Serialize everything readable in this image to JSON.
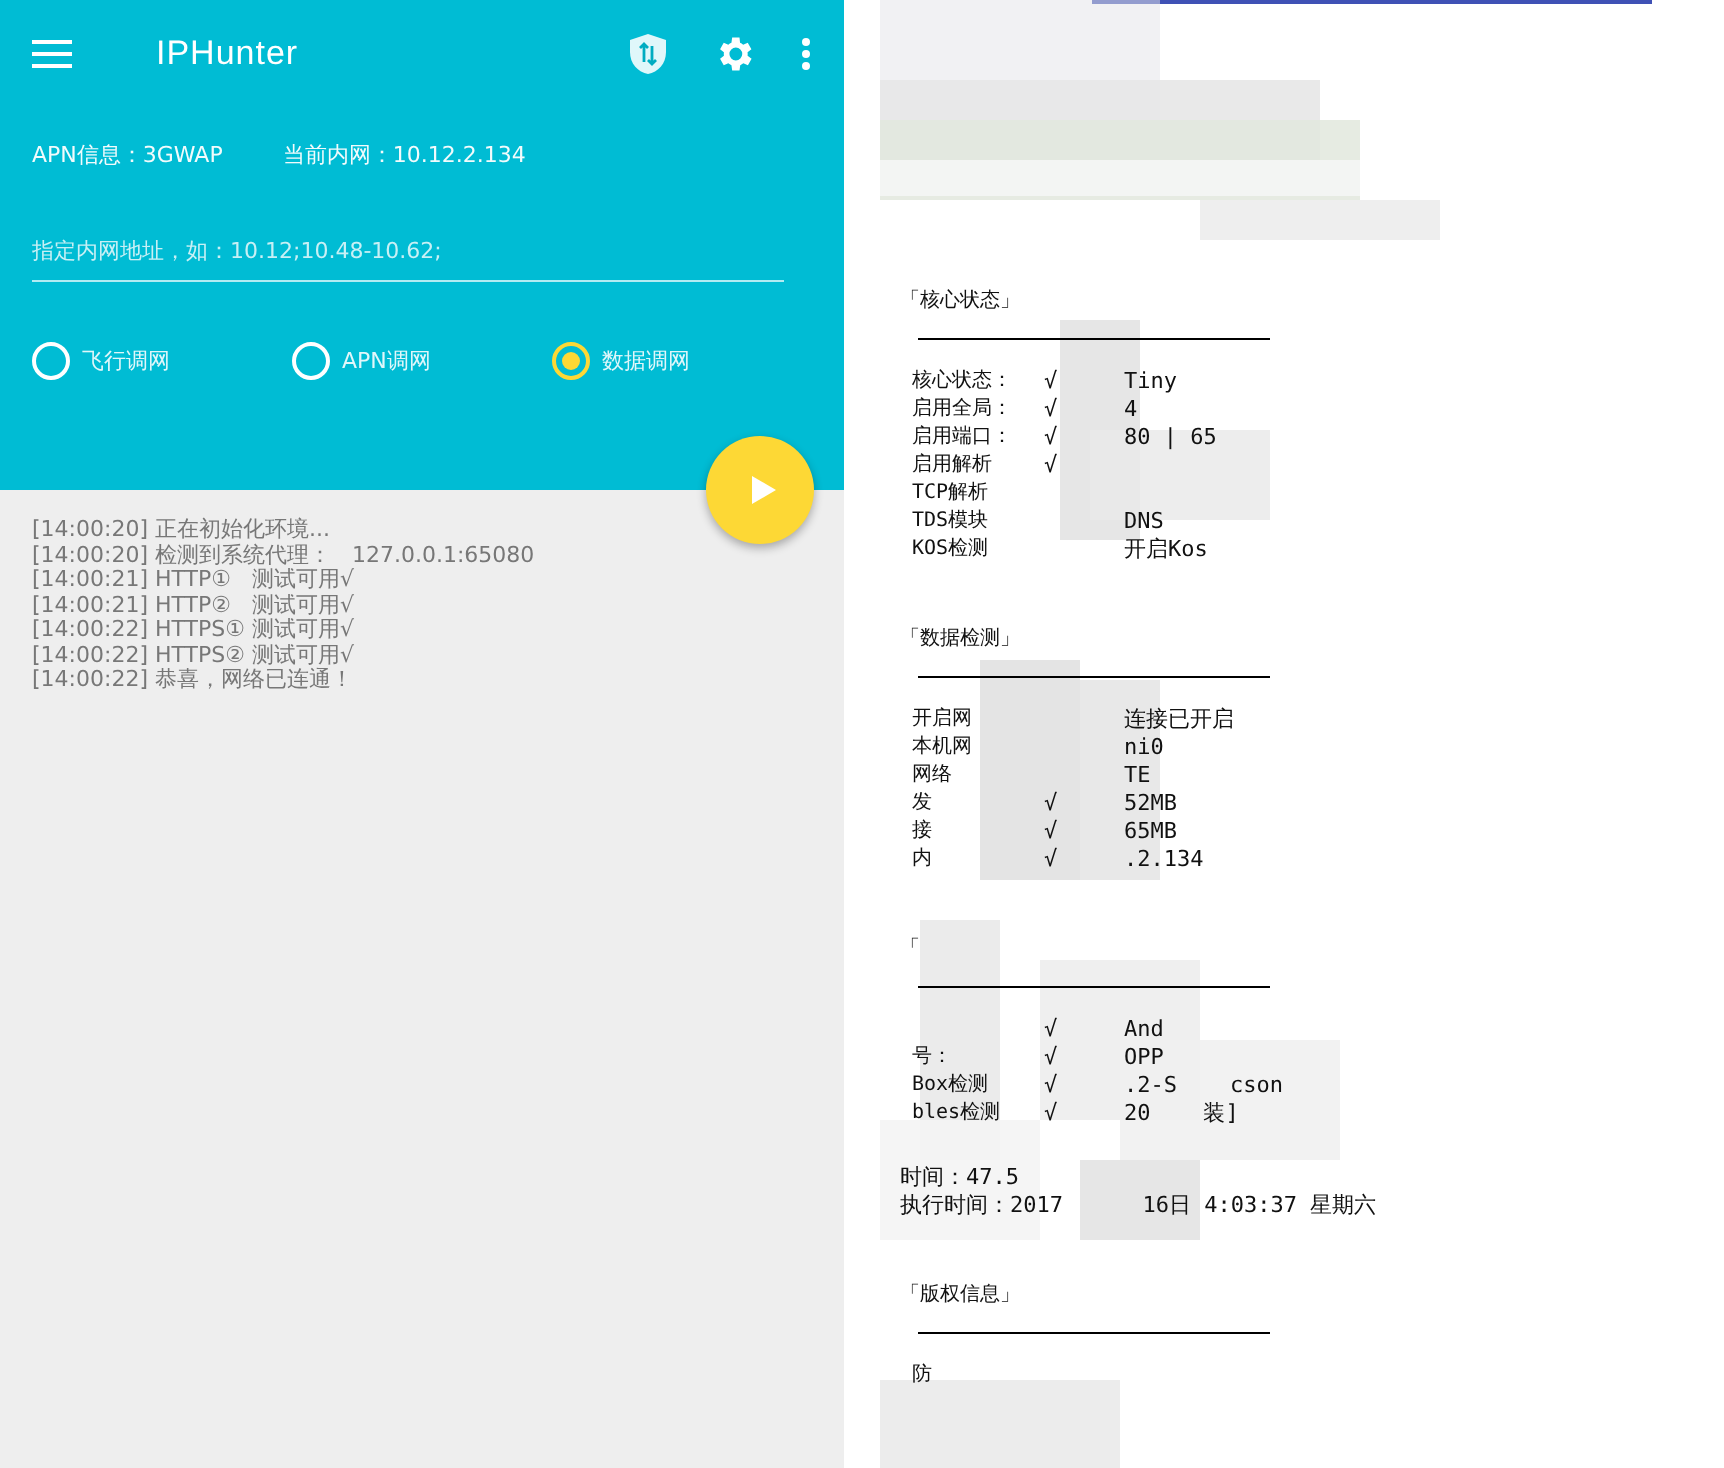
{
  "app_bar": {
    "title": "IPHunter"
  },
  "info": {
    "apn": "APN信息：3GWAP",
    "intranet": "当前内网：10.12.2.134"
  },
  "address_field": {
    "placeholder": "指定内网地址，如：10.12;10.48-10.62;"
  },
  "modes": [
    {
      "label": "飞行调网",
      "selected": false
    },
    {
      "label": "APN调网",
      "selected": false
    },
    {
      "label": "数据调网",
      "selected": true
    }
  ],
  "log": [
    "[14:00:20] 正在初始化环境...",
    "[14:00:20] 检测到系统代理：   127.0.0.1:65080",
    "[14:00:21] HTTP①   测试可用√",
    "[14:00:21] HTTP②   测试可用√",
    "[14:00:22] HTTPS① 测试可用√",
    "[14:00:22] HTTPS② 测试可用√",
    "[14:00:22] 恭喜，网络已连通！"
  ],
  "report": {
    "sections": [
      {
        "title": "「核心状态」",
        "rows": [
          {
            "label": "核心状态：",
            "check": "√",
            "value": "Tiny"
          },
          {
            "label": "启用全局：",
            "check": "√",
            "value": "4"
          },
          {
            "label": "启用端口：",
            "check": "√",
            "value": "80 | 65"
          },
          {
            "label": "启用解析",
            "check": "√"
          },
          {
            "label": "TCP解析"
          },
          {
            "label": "TDS模块",
            "value": "DNS"
          },
          {
            "label": "KOS检测",
            "value": "开启Kos"
          }
        ]
      },
      {
        "title": "「数据检测」",
        "rows": [
          {
            "label": "开启网",
            "value": "连接已开启"
          },
          {
            "label": "本机网",
            "value": "ni0"
          },
          {
            "label": "网络",
            "value": "TE"
          },
          {
            "label": "发",
            "check": "√",
            "value": "52MB"
          },
          {
            "label": "接",
            "check": "√",
            "value": "65MB"
          },
          {
            "label": "内",
            "check": "√",
            "value": ".2.134"
          }
        ]
      },
      {
        "title": "「",
        "rows": [
          {
            "label": "",
            "check": "√",
            "value": "And"
          },
          {
            "label": "号：",
            "check": "√",
            "value": "OPP"
          },
          {
            "label": "Box检测",
            "check": "√",
            "value": ".2-S    cson"
          },
          {
            "label": "bles检测",
            "check": "√",
            "value": "20    装]"
          }
        ],
        "notes": [
          "时间：47.5",
          "执行时间：2017      16日 4:03:37 星期六"
        ]
      },
      {
        "title": "「版权信息」",
        "rows": [
          {
            "label": "防"
          }
        ]
      }
    ]
  }
}
